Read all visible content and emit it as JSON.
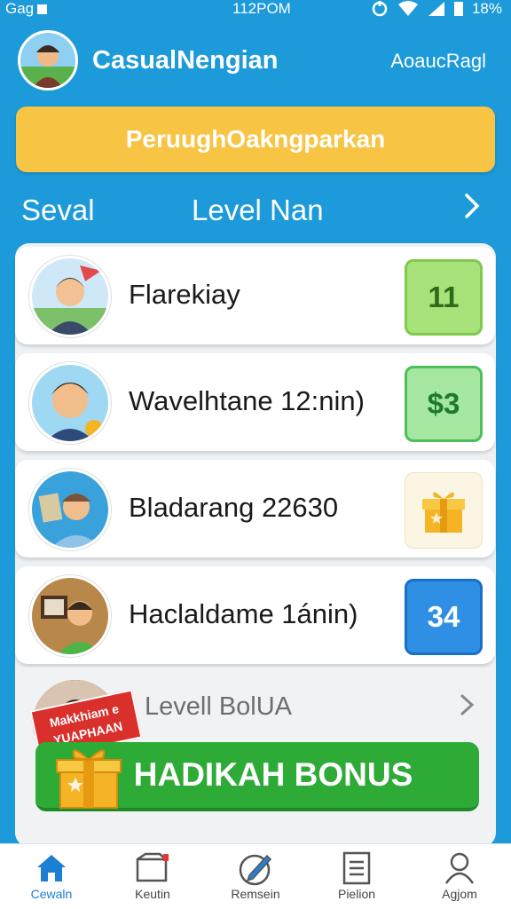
{
  "status_bar": {
    "left_text": "Gag",
    "time": "112POM",
    "battery": "18%"
  },
  "header": {
    "title": "CasualNengian",
    "link": "AoaucRagl",
    "avatar_icon": "user-avatar"
  },
  "banner": {
    "label": "PeruughOakngparkan"
  },
  "level_bar": {
    "left": "Seval",
    "center": "Level Nan"
  },
  "rows": [
    {
      "name": "Flarekiay",
      "badge": "11",
      "badge_type": "green"
    },
    {
      "name": "Wavelhtane 12:nin)",
      "badge": "$3",
      "badge_type": "green-dark"
    },
    {
      "name": "Bladarang 22630",
      "badge": "",
      "badge_type": "gift",
      "badge_icon": "gift-icon"
    },
    {
      "name": "Haclaldame 1ánin)",
      "badge": "34",
      "badge_type": "blue"
    }
  ],
  "bonus": {
    "label": "Levell BolUA",
    "ribbon_text": "Makkhiam e YUAPHAAN",
    "button_label": "HADIKAH BONUS"
  },
  "bottom_nav": [
    {
      "label": "Cewaln",
      "icon": "home-icon",
      "active": true
    },
    {
      "label": "Keutin",
      "icon": "inbox-icon",
      "active": false
    },
    {
      "label": "Remsein",
      "icon": "edit-icon",
      "active": false
    },
    {
      "label": "Pielion",
      "icon": "list-icon",
      "active": false
    },
    {
      "label": "Agjom",
      "icon": "user-icon",
      "active": false
    }
  ],
  "colors": {
    "background": "#1c9ad9",
    "banner": "#f7c443",
    "bonus_button": "#2eab37",
    "active_nav": "#1c7fd3"
  }
}
